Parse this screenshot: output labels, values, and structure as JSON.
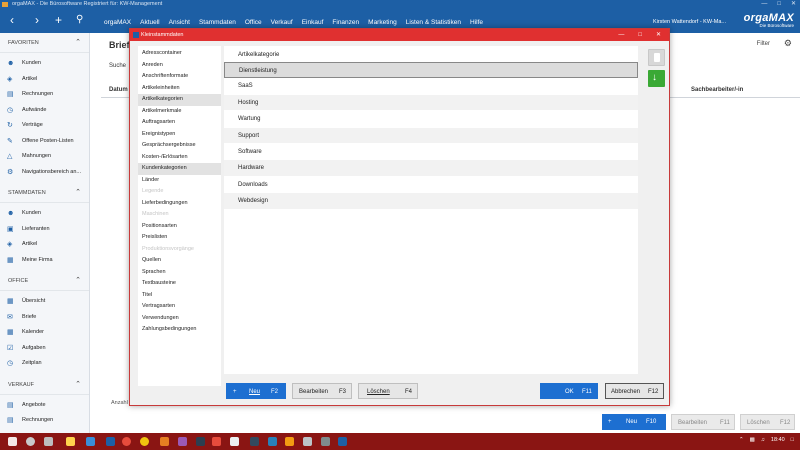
{
  "window": {
    "title": "orgaMAX - Die Bürosoftware Registriert für: KW-Management"
  },
  "menubar": {
    "items": [
      "orgaMAX",
      "Aktuell",
      "Ansicht",
      "Stammdaten",
      "Office",
      "Verkauf",
      "Einkauf",
      "Finanzen",
      "Marketing",
      "Listen & Statistiken",
      "Hilfe"
    ],
    "user": "Kirsten Wattendorf - KW-Ma...",
    "brand": "orgaMAX",
    "brand_tag": "Die Bürosoftware"
  },
  "sidebar": {
    "sections": [
      {
        "title": "FAVORITEN",
        "items": [
          {
            "label": "Kunden",
            "icon": "users-icon"
          },
          {
            "label": "Artikel",
            "icon": "tag-icon"
          },
          {
            "label": "Rechnungen",
            "icon": "receipt-icon"
          },
          {
            "label": "Aufwände",
            "icon": "clock-icon"
          },
          {
            "label": "Verträge",
            "icon": "refresh-icon"
          },
          {
            "label": "Offene Posten-Listen",
            "icon": "pen-icon"
          },
          {
            "label": "Mahnungen",
            "icon": "warning-icon"
          },
          {
            "label": "Navigationsbereich an...",
            "icon": "gear-icon"
          }
        ]
      },
      {
        "title": "STAMMDATEN",
        "items": [
          {
            "label": "Kunden",
            "icon": "users-icon"
          },
          {
            "label": "Lieferanten",
            "icon": "truck-icon"
          },
          {
            "label": "Artikel",
            "icon": "tag-icon"
          },
          {
            "label": "Meine Firma",
            "icon": "building-icon"
          }
        ]
      },
      {
        "title": "OFFICE",
        "items": [
          {
            "label": "Übersicht",
            "icon": "grid-icon"
          },
          {
            "label": "Briefe",
            "icon": "mail-icon"
          },
          {
            "label": "Kalender",
            "icon": "calendar-icon"
          },
          {
            "label": "Aufgaben",
            "icon": "tasks-icon"
          },
          {
            "label": "Zeitplan",
            "icon": "clock-icon"
          }
        ]
      },
      {
        "title": "VERKAUF",
        "items": [
          {
            "label": "Angebote",
            "icon": "document-icon"
          },
          {
            "label": "Rechnungen",
            "icon": "receipt-icon"
          }
        ]
      }
    ]
  },
  "main": {
    "title": "Briefe",
    "search_label": "Suche",
    "col_datum": "Datum",
    "col_sachbearbeiter": "Sachbearbeiter/-in",
    "filter_label": "Filter",
    "footer_label": "Anzahl",
    "buttons": {
      "neu": "Neu",
      "neu_key": "F10",
      "bearbeiten": "Bearbeiten",
      "bearbeiten_key": "F11",
      "loeschen": "Löschen",
      "loeschen_key": "F12"
    }
  },
  "dialog": {
    "title": "Kleinstammdaten",
    "categories": [
      {
        "label": "Adresscontainer",
        "state": "normal"
      },
      {
        "label": "Anreden",
        "state": "normal"
      },
      {
        "label": "Anschriftenformate",
        "state": "normal"
      },
      {
        "label": "Artikeleinheiten",
        "state": "normal"
      },
      {
        "label": "Artikelkategorien",
        "state": "selected"
      },
      {
        "label": "Artikelmerkmale",
        "state": "normal"
      },
      {
        "label": "Auftragsarten",
        "state": "normal"
      },
      {
        "label": "Ereignistypen",
        "state": "normal"
      },
      {
        "label": "Gesprächsergebnisse",
        "state": "normal"
      },
      {
        "label": "Kosten-/Erlösarten",
        "state": "normal"
      },
      {
        "label": "Kundenkategorien",
        "state": "selected"
      },
      {
        "label": "Länder",
        "state": "normal"
      },
      {
        "label": "Legende",
        "state": "disabled"
      },
      {
        "label": "Lieferbedingungen",
        "state": "normal"
      },
      {
        "label": "Maschinen",
        "state": "disabled"
      },
      {
        "label": "Positionsarten",
        "state": "normal"
      },
      {
        "label": "Preislisten",
        "state": "normal"
      },
      {
        "label": "Produktionsvorgänge",
        "state": "disabled"
      },
      {
        "label": "Quellen",
        "state": "normal"
      },
      {
        "label": "Sprachen",
        "state": "normal"
      },
      {
        "label": "Textbausteine",
        "state": "normal"
      },
      {
        "label": "Titel",
        "state": "normal"
      },
      {
        "label": "Vertragsarten",
        "state": "normal"
      },
      {
        "label": "Verwendungen",
        "state": "normal"
      },
      {
        "label": "Zahlungsbedingungen",
        "state": "normal"
      }
    ],
    "list_header": "Artikelkategorie",
    "list_items": [
      "Dienstleistung",
      "SaaS",
      "Hosting",
      "Wartung",
      "Support",
      "Software",
      "Hardware",
      "Downloads",
      "Webdesign"
    ],
    "selected_index": 0,
    "buttons": {
      "neu": "Neu",
      "neu_key": "F2",
      "bearbeiten": "Bearbeiten",
      "bearbeiten_key": "F3",
      "loeschen": "Löschen",
      "loeschen_key": "F4",
      "ok": "OK",
      "ok_key": "F11",
      "abbrechen": "Abbrechen",
      "abbrechen_key": "F12"
    }
  },
  "taskbar": {
    "time": "18:40"
  },
  "colors": {
    "accent": "#1d5fa5",
    "dialog_title": "#e03030",
    "taskbar": "#8a1513",
    "ok_button": "#1d6fd1"
  }
}
